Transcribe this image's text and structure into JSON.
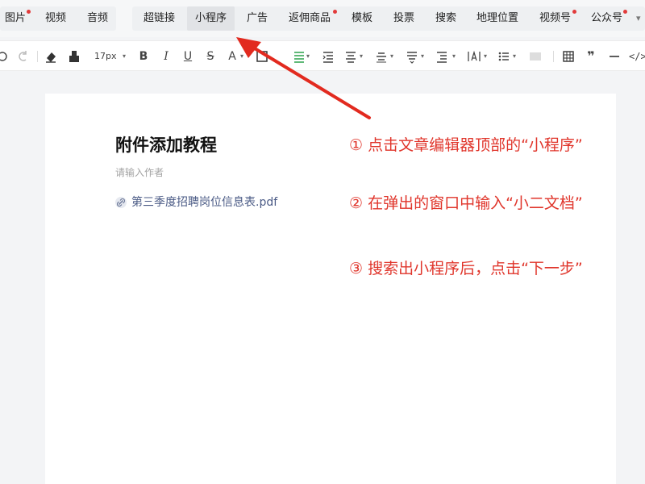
{
  "menu": {
    "tabs": [
      {
        "label": "图片",
        "dot": true
      },
      {
        "label": "视频",
        "dot": false
      },
      {
        "label": "音频",
        "dot": false
      },
      {
        "label": "超链接",
        "dot": false
      },
      {
        "label": "小程序",
        "dot": false,
        "active": true
      },
      {
        "label": "广告",
        "dot": false
      },
      {
        "label": "返佣商品",
        "dot": true
      },
      {
        "label": "模板",
        "dot": false
      },
      {
        "label": "投票",
        "dot": false
      },
      {
        "label": "搜索",
        "dot": false
      },
      {
        "label": "地理位置",
        "dot": false
      },
      {
        "label": "视频号",
        "dot": true
      },
      {
        "label": "公众号",
        "dot": true
      }
    ]
  },
  "toolbar": {
    "font_size": "17px",
    "bold": "B",
    "italic": "I",
    "underline": "U",
    "strike": "S",
    "font_color": "A",
    "quote": "❞",
    "code": "</>"
  },
  "editor": {
    "title": "附件添加教程",
    "author_placeholder": "请输入作者",
    "attachment": "第三季度招聘岗位信息表.pdf"
  },
  "annotations": {
    "step1": "① 点击文章编辑器顶部的“小程序”",
    "step2": "② 在弹出的窗口中输入“小二文档”",
    "step3": "③ 搜索出小程序后，点击“下一步”"
  },
  "colors": {
    "annotation": "#e0352b",
    "link": "#4a5a85",
    "active_tab": "#e1e3e6"
  }
}
